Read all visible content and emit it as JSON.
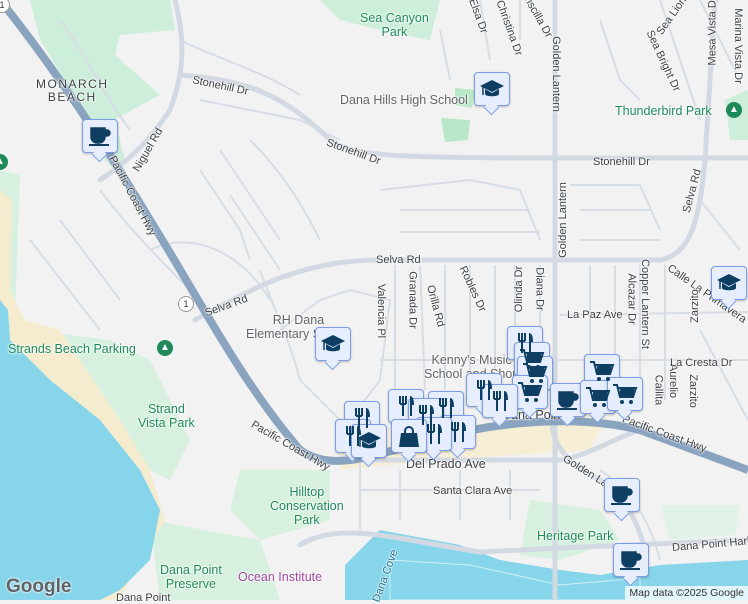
{
  "map": {
    "areas": {
      "monarch_beach_1": "MONARCH",
      "monarch_beach_2": "BEACH"
    },
    "parks": {
      "sea_canyon_1": "Sea Canyon",
      "sea_canyon_2": "Park",
      "thunderbird": "Thunderbird Park",
      "strands_parking": "Strands Beach Parking",
      "strand_vista_1": "Strand",
      "strand_vista_2": "Vista Park",
      "hilltop_1": "Hilltop",
      "hilltop_2": "Conservation",
      "hilltop_3": "Park",
      "heritage": "Heritage Park",
      "preserve_1": "Dana Point",
      "preserve_2": "Preserve",
      "ocean_institute": "Ocean Institute"
    },
    "pois": {
      "dana_hills": "Dana Hills High School",
      "rh_dana_1": "RH Dana",
      "rh_dana_2": "Elementary School",
      "kennys_1": "Kenny's Music",
      "kennys_2": "School and Shop",
      "dana_point_town": "Dana Point",
      "dana_point_bottom": "Dana Point"
    },
    "streets": {
      "stonehill": "Stonehill Dr",
      "niguel": "Niguel Rd",
      "pch": "Pacific Coast Hwy",
      "golden_lantern": "Golden Lantern",
      "selva": "Selva Rd",
      "elsa": "Elsa Dr",
      "christina": "Christina Dr",
      "priscilla": "Priscilla Dr",
      "sea_bright": "Sea Bright Dr",
      "sea_lion": "Sea Lion",
      "mesa_vista": "Mesa Vista Dr",
      "marina_vista": "Marina Vista Dr",
      "valencia": "Valencia Pl",
      "granada": "Granada Dr",
      "orilla": "Orilla Rd",
      "robles": "Robles Dr",
      "olinda": "Olinda Dr",
      "diana": "Diana Dr",
      "alcazar": "Alcazar Dr",
      "copper_lantern": "Copper Lantern St",
      "calle_la_primavera": "Calle La Primavera",
      "zarzito": "Zarzito",
      "aurelio": "Aurelio",
      "callita": "Callita",
      "la_paz": "La Paz Ave",
      "la_cresta": "La Cresta Dr",
      "del_prado": "Del Prado Ave",
      "santa_clara": "Santa Clara Ave",
      "golden_l": "Golden Lantern",
      "dana_point_harbor": "Dana Point Harbor",
      "dana_cove": "Dana Cove",
      "route": "1"
    },
    "attribution": "Map data ©2025 Google",
    "logo": "Google"
  },
  "colors": {
    "water": "#86d5ea",
    "park": "#c9eed6",
    "highway": "#8aa4c0",
    "road": "#d5dbe4",
    "marker_fill": "#e6eefe",
    "marker_icon": "#0e3f63"
  }
}
